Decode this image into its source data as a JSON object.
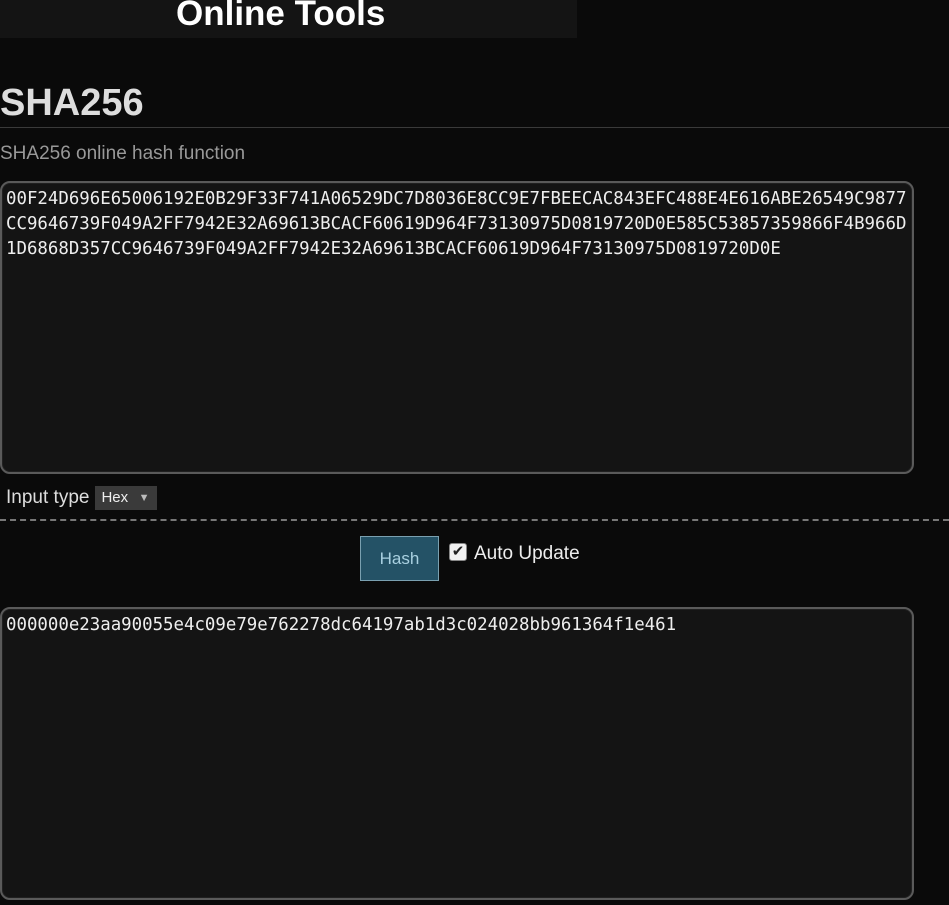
{
  "header": {
    "site_title": "Online Tools"
  },
  "page": {
    "title": "SHA256",
    "subtitle": "SHA256 online hash function"
  },
  "input": {
    "value": "00F24D696E65006192E0B29F33F741A06529DC7D8036E8CC9E7FBEECAC843EFC488E4E616ABE26549C9877CC9646739F049A2FF7942E32A69613BCACF60619D964F73130975D0819720D0E585C53857359866F4B966D1D6868D357CC9646739F049A2FF7942E32A69613BCACF60619D964F73130975D0819720D0E"
  },
  "input_type": {
    "label": "Input type",
    "selected": "Hex",
    "icon": "triangle-down-icon"
  },
  "controls": {
    "hash_label": "Hash",
    "auto_update_label": "Auto Update",
    "auto_update_checked": true,
    "check_glyph": "✔"
  },
  "output": {
    "value": "000000e23aa90055e4c09e79e762278dc64197ab1d3c024028bb961364f1e461"
  },
  "colors": {
    "background": "#0a0a0a",
    "box_background": "#141414",
    "button_background": "#245266",
    "button_text": "#a9d0e0"
  }
}
